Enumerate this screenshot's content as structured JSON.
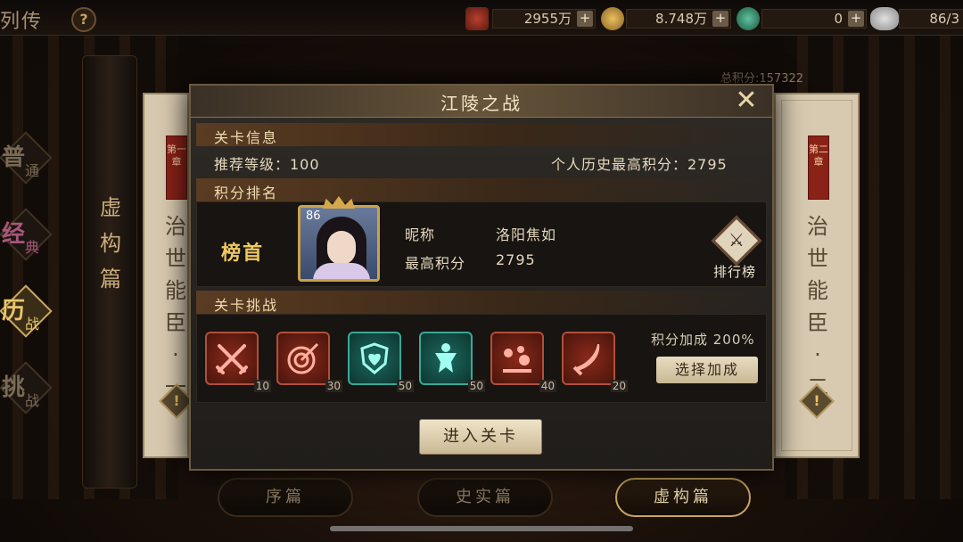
{
  "topbar": {
    "title_fragment": "列传",
    "help_label": "?",
    "resources": [
      {
        "icon": "scroll-icon",
        "value": "2955万",
        "plus": "+"
      },
      {
        "icon": "coin-icon",
        "value": "8.748万",
        "plus": "+"
      },
      {
        "icon": "jade-icon",
        "value": "0",
        "plus": "+"
      },
      {
        "icon": "stone-icon",
        "value": "86/3"
      }
    ]
  },
  "left_scroll": {
    "label": "虚构篇"
  },
  "difficulty": [
    {
      "big": "普",
      "small": "通",
      "color": "#7a6a54"
    },
    {
      "big": "经",
      "small": "典",
      "color": "#a8567a"
    },
    {
      "big": "历",
      "small": "战",
      "color": "#c9a660"
    },
    {
      "big": "挑",
      "small": "战",
      "color": "#7a6a54"
    }
  ],
  "chapter_left": {
    "seal": "第一章",
    "title": "治世能臣·一",
    "warn": "!"
  },
  "chapter_right": {
    "seal": "第二章",
    "title": "治世能臣·二",
    "warn": "!"
  },
  "total_score": "总积分:157322",
  "bottom_tabs": [
    "序篇",
    "史实篇",
    "虚构篇"
  ],
  "modal": {
    "title": "江陵之战",
    "close": "✕",
    "info_header": "关卡信息",
    "recommended_level": "推荐等级：100",
    "personal_best": "个人历史最高积分：2795",
    "ranking_header": "积分排名",
    "rank_label": "榜首",
    "portrait_level": "86",
    "nickname_label": "昵称",
    "nickname_value": "洛阳焦如",
    "score_label": "最高积分",
    "score_value": "2795",
    "leaderboard_label": "排行榜",
    "challenge_header": "关卡挑战",
    "challenges": [
      {
        "icon": "crossed-swords-icon",
        "value": "10",
        "color": "red"
      },
      {
        "icon": "target-icon",
        "value": "30",
        "color": "red"
      },
      {
        "icon": "heart-shield-icon",
        "value": "50",
        "color": "teal"
      },
      {
        "icon": "warrior-icon",
        "value": "50",
        "color": "teal"
      },
      {
        "icon": "orbs-icon",
        "value": "40",
        "color": "red"
      },
      {
        "icon": "saber-icon",
        "value": "20",
        "color": "red"
      }
    ],
    "bonus_text": "积分加成 200%",
    "select_bonus_label": "选择加成",
    "enter_label": "进入关卡"
  }
}
